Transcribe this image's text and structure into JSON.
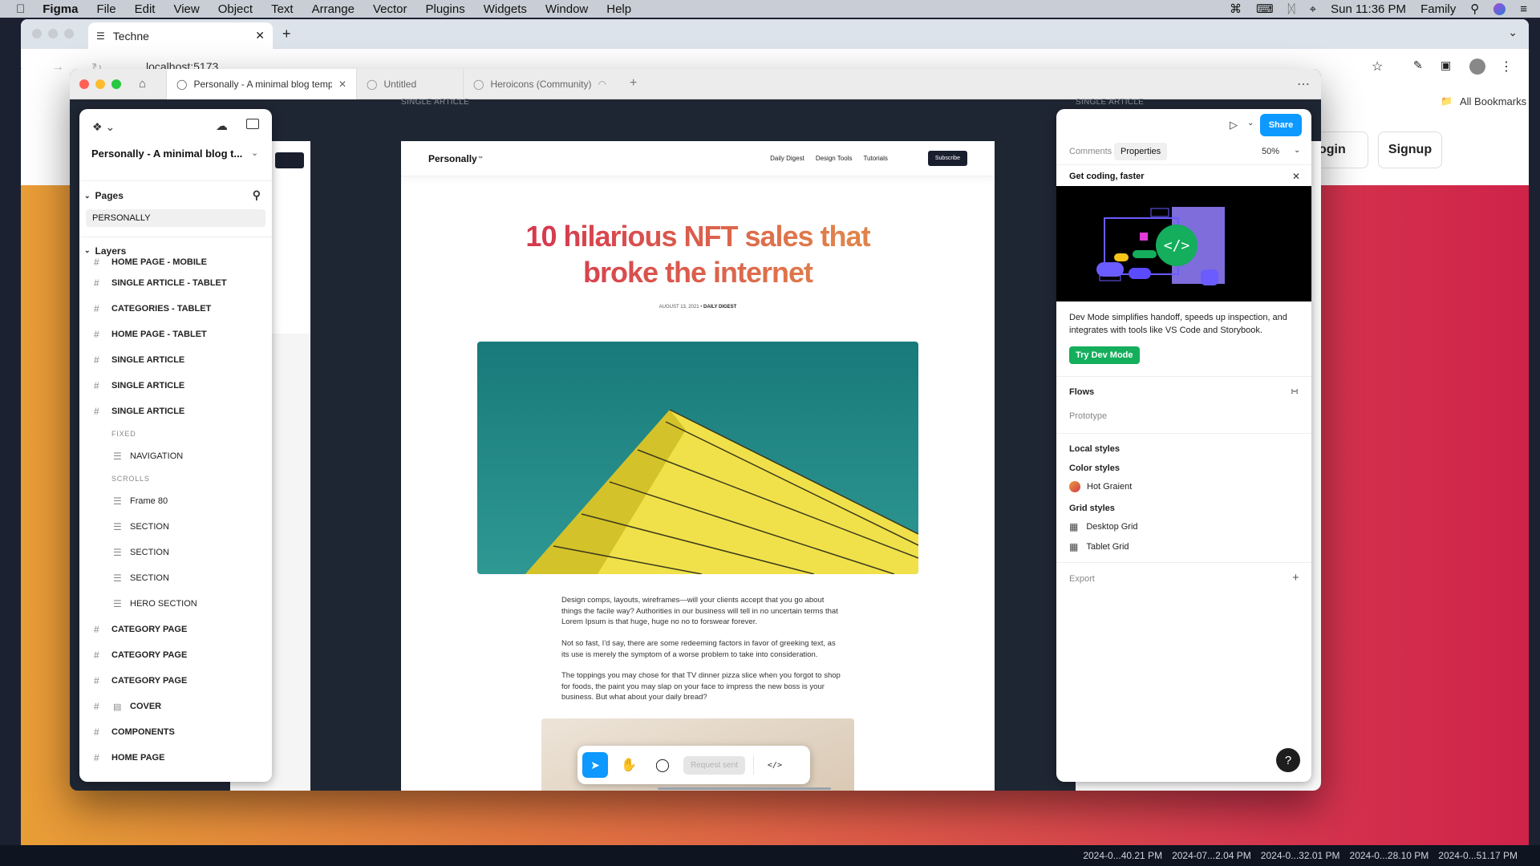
{
  "menubar": {
    "app": "Figma",
    "items": [
      "File",
      "Edit",
      "View",
      "Object",
      "Text",
      "Arrange",
      "Vector",
      "Plugins",
      "Widgets",
      "Window",
      "Help"
    ],
    "clock": "Sun 11:36 PM",
    "user": "Family"
  },
  "chrome": {
    "tab_title": "Techne",
    "url": "localhost:5173",
    "bookmarks": "All Bookmarks",
    "bg_buttons": [
      "Login",
      "Signup"
    ]
  },
  "figma": {
    "tabs": [
      {
        "label": "Personally - A minimal blog temp"
      },
      {
        "label": "Untitled"
      },
      {
        "label": "Heroicons (Community)"
      }
    ],
    "frame_label_left": "SINGLE ARTICLE",
    "frame_label_right": "SINGLE ARTICLE",
    "left_panel": {
      "file_name": "Personally - A minimal blog t...",
      "pages_label": "Pages",
      "current_page": "PERSONALLY",
      "layers_label": "Layers",
      "layers": [
        {
          "label": "HOME PAGE - MOBILE",
          "type": "frame"
        },
        {
          "label": "SINGLE ARTICLE - TABLET",
          "type": "frame"
        },
        {
          "label": "CATEGORIES - TABLET",
          "type": "frame"
        },
        {
          "label": "HOME PAGE - TABLET",
          "type": "frame"
        },
        {
          "label": "SINGLE ARTICLE",
          "type": "frame"
        },
        {
          "label": "SINGLE ARTICLE",
          "type": "frame"
        },
        {
          "label": "SINGLE ARTICLE",
          "type": "frame"
        },
        {
          "label": "FIXED",
          "type": "group"
        },
        {
          "label": "NAVIGATION",
          "type": "child"
        },
        {
          "label": "SCROLLS",
          "type": "group"
        },
        {
          "label": "Frame 80",
          "type": "child"
        },
        {
          "label": "SECTION",
          "type": "child"
        },
        {
          "label": "SECTION",
          "type": "child"
        },
        {
          "label": "SECTION",
          "type": "child"
        },
        {
          "label": "HERO SECTION",
          "type": "child"
        },
        {
          "label": "CATEGORY PAGE",
          "type": "frame"
        },
        {
          "label": "CATEGORY PAGE",
          "type": "frame"
        },
        {
          "label": "CATEGORY PAGE",
          "type": "frame"
        },
        {
          "label": "COVER",
          "type": "frame"
        },
        {
          "label": "COMPONENTS",
          "type": "frame"
        },
        {
          "label": "HOME PAGE",
          "type": "frame"
        }
      ]
    },
    "article": {
      "logo": "Personally",
      "nav": [
        "Daily Digest",
        "Design Tools",
        "Tutorials"
      ],
      "subscribe": "Subscribe",
      "headline_1": "10 hilarious NFT sales that",
      "headline_2": "broke the internet",
      "meta": "AUGUST 13, 2021 •",
      "meta_category": "DAILY DIGEST",
      "paragraphs": [
        "Design comps, layouts, wireframes—will your clients accept that you go about things the facile way? Authorities in our business will tell in no uncertain terms that Lorem Ipsum is that huge, huge no no to forswear forever.",
        "Not so fast, I'd say, there are some redeeming factors in favor of greeking text, as its use is merely the symptom of a worse problem to take into consideration.",
        "The toppings you may chose for that TV dinner pizza slice when you forgot to shop for foods, the paint you may slap on your face to impress the new boss is your business. But what about your daily bread?"
      ]
    },
    "right_panel": {
      "share": "Share",
      "tab_comments": "Comments",
      "tab_properties": "Properties",
      "zoom": "50%",
      "promo_title": "Get coding, faster",
      "promo_text": "Dev Mode simplifies handoff, speeds up inspection, and integrates with tools like VS Code and Storybook.",
      "promo_button": "Try Dev Mode",
      "flows": "Flows",
      "prototype": "Prototype",
      "local_styles": "Local styles",
      "color_styles": "Color styles",
      "color_style_name": "Hot Graient",
      "grid_styles": "Grid styles",
      "grid_items": [
        "Desktop Grid",
        "Tablet Grid"
      ],
      "export": "Export",
      "help": "?"
    },
    "toolbar": {
      "request_sent": "Request sent"
    }
  },
  "bottom_strip": {
    "timestamps": [
      "2024-0...40.21 PM",
      "2024-07...2.04 PM",
      "2024-0...32.01 PM",
      "2024-0...28.10 PM",
      "2024-0...51.17 PM"
    ]
  },
  "colors": {
    "figma_blue": "#0d99ff",
    "dev_green": "#14ae5c",
    "headline_start": "#d63a4f",
    "headline_end": "#e0834a"
  }
}
